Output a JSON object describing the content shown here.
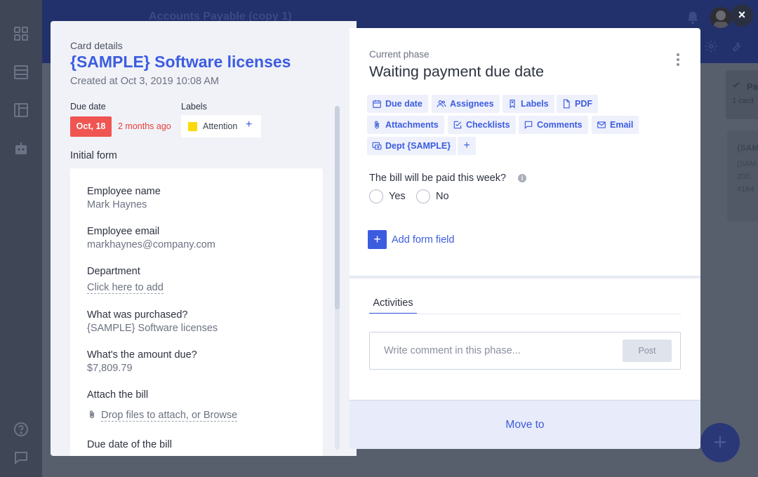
{
  "background": {
    "board_title": "Accounts Payable (copy 1)",
    "phase_column": {
      "title": "Pa",
      "count": "1 card"
    },
    "card": {
      "title": "{SAM",
      "line1": "{SAM",
      "line2": "200.",
      "line3": "4164"
    },
    "fab_symbol": "+"
  },
  "modal": {
    "close_symbol": "×"
  },
  "card_details": {
    "section_label": "Card details",
    "title": "{SAMPLE} Software licenses",
    "created": "Created at Oct 3, 2019 10:08 AM",
    "due_date": {
      "label": "Due date",
      "value": "Oct, 18",
      "relative": "2 months ago"
    },
    "labels": {
      "label": "Labels",
      "items": [
        {
          "name": "Attention",
          "color": "#fcd90a"
        }
      ],
      "add_symbol": "+"
    },
    "initial_form": {
      "heading": "Initial form",
      "fields": [
        {
          "label": "Employee name",
          "value": "Mark Haynes"
        },
        {
          "label": "Employee email",
          "value": "markhaynes@company.com"
        },
        {
          "label": "Department",
          "value": "Click here to add"
        },
        {
          "label": "What was purchased?",
          "value": "{SAMPLE} Software licenses"
        },
        {
          "label": "What's the amount due?",
          "value": "$7,809.79"
        },
        {
          "label": "Attach the bill",
          "value": "Drop files to attach, or Browse"
        },
        {
          "label": "Due date of the bill",
          "value": ""
        }
      ]
    }
  },
  "phase": {
    "label": "Current phase",
    "title": "Waiting payment due date",
    "toolbar": [
      {
        "label": "Due date",
        "icon": "calendar-icon"
      },
      {
        "label": "Assignees",
        "icon": "users-icon"
      },
      {
        "label": "Labels",
        "icon": "tag-icon"
      },
      {
        "label": "PDF",
        "icon": "document-icon"
      },
      {
        "label": "Attachments",
        "icon": "paperclip-icon"
      },
      {
        "label": "Checklists",
        "icon": "checklist-icon"
      },
      {
        "label": "Comments",
        "icon": "comment-icon"
      },
      {
        "label": "Email",
        "icon": "mail-icon"
      },
      {
        "label": "Dept {SAMPLE}",
        "icon": "connection-icon"
      }
    ],
    "toolbar_add_symbol": "+",
    "question": {
      "label": "The bill will be paid this week?",
      "info_symbol": "i",
      "options": [
        "Yes",
        "No"
      ]
    },
    "add_form_field": {
      "symbol": "+",
      "label": "Add form field"
    },
    "tabs": [
      "Activities"
    ],
    "comment": {
      "placeholder": "Write comment in this phase...",
      "post_label": "Post"
    },
    "move_to_label": "Move to"
  },
  "colors": {
    "accent": "#3c5ce0",
    "overdue": "#f05552",
    "label_attention": "#fcd90a"
  }
}
